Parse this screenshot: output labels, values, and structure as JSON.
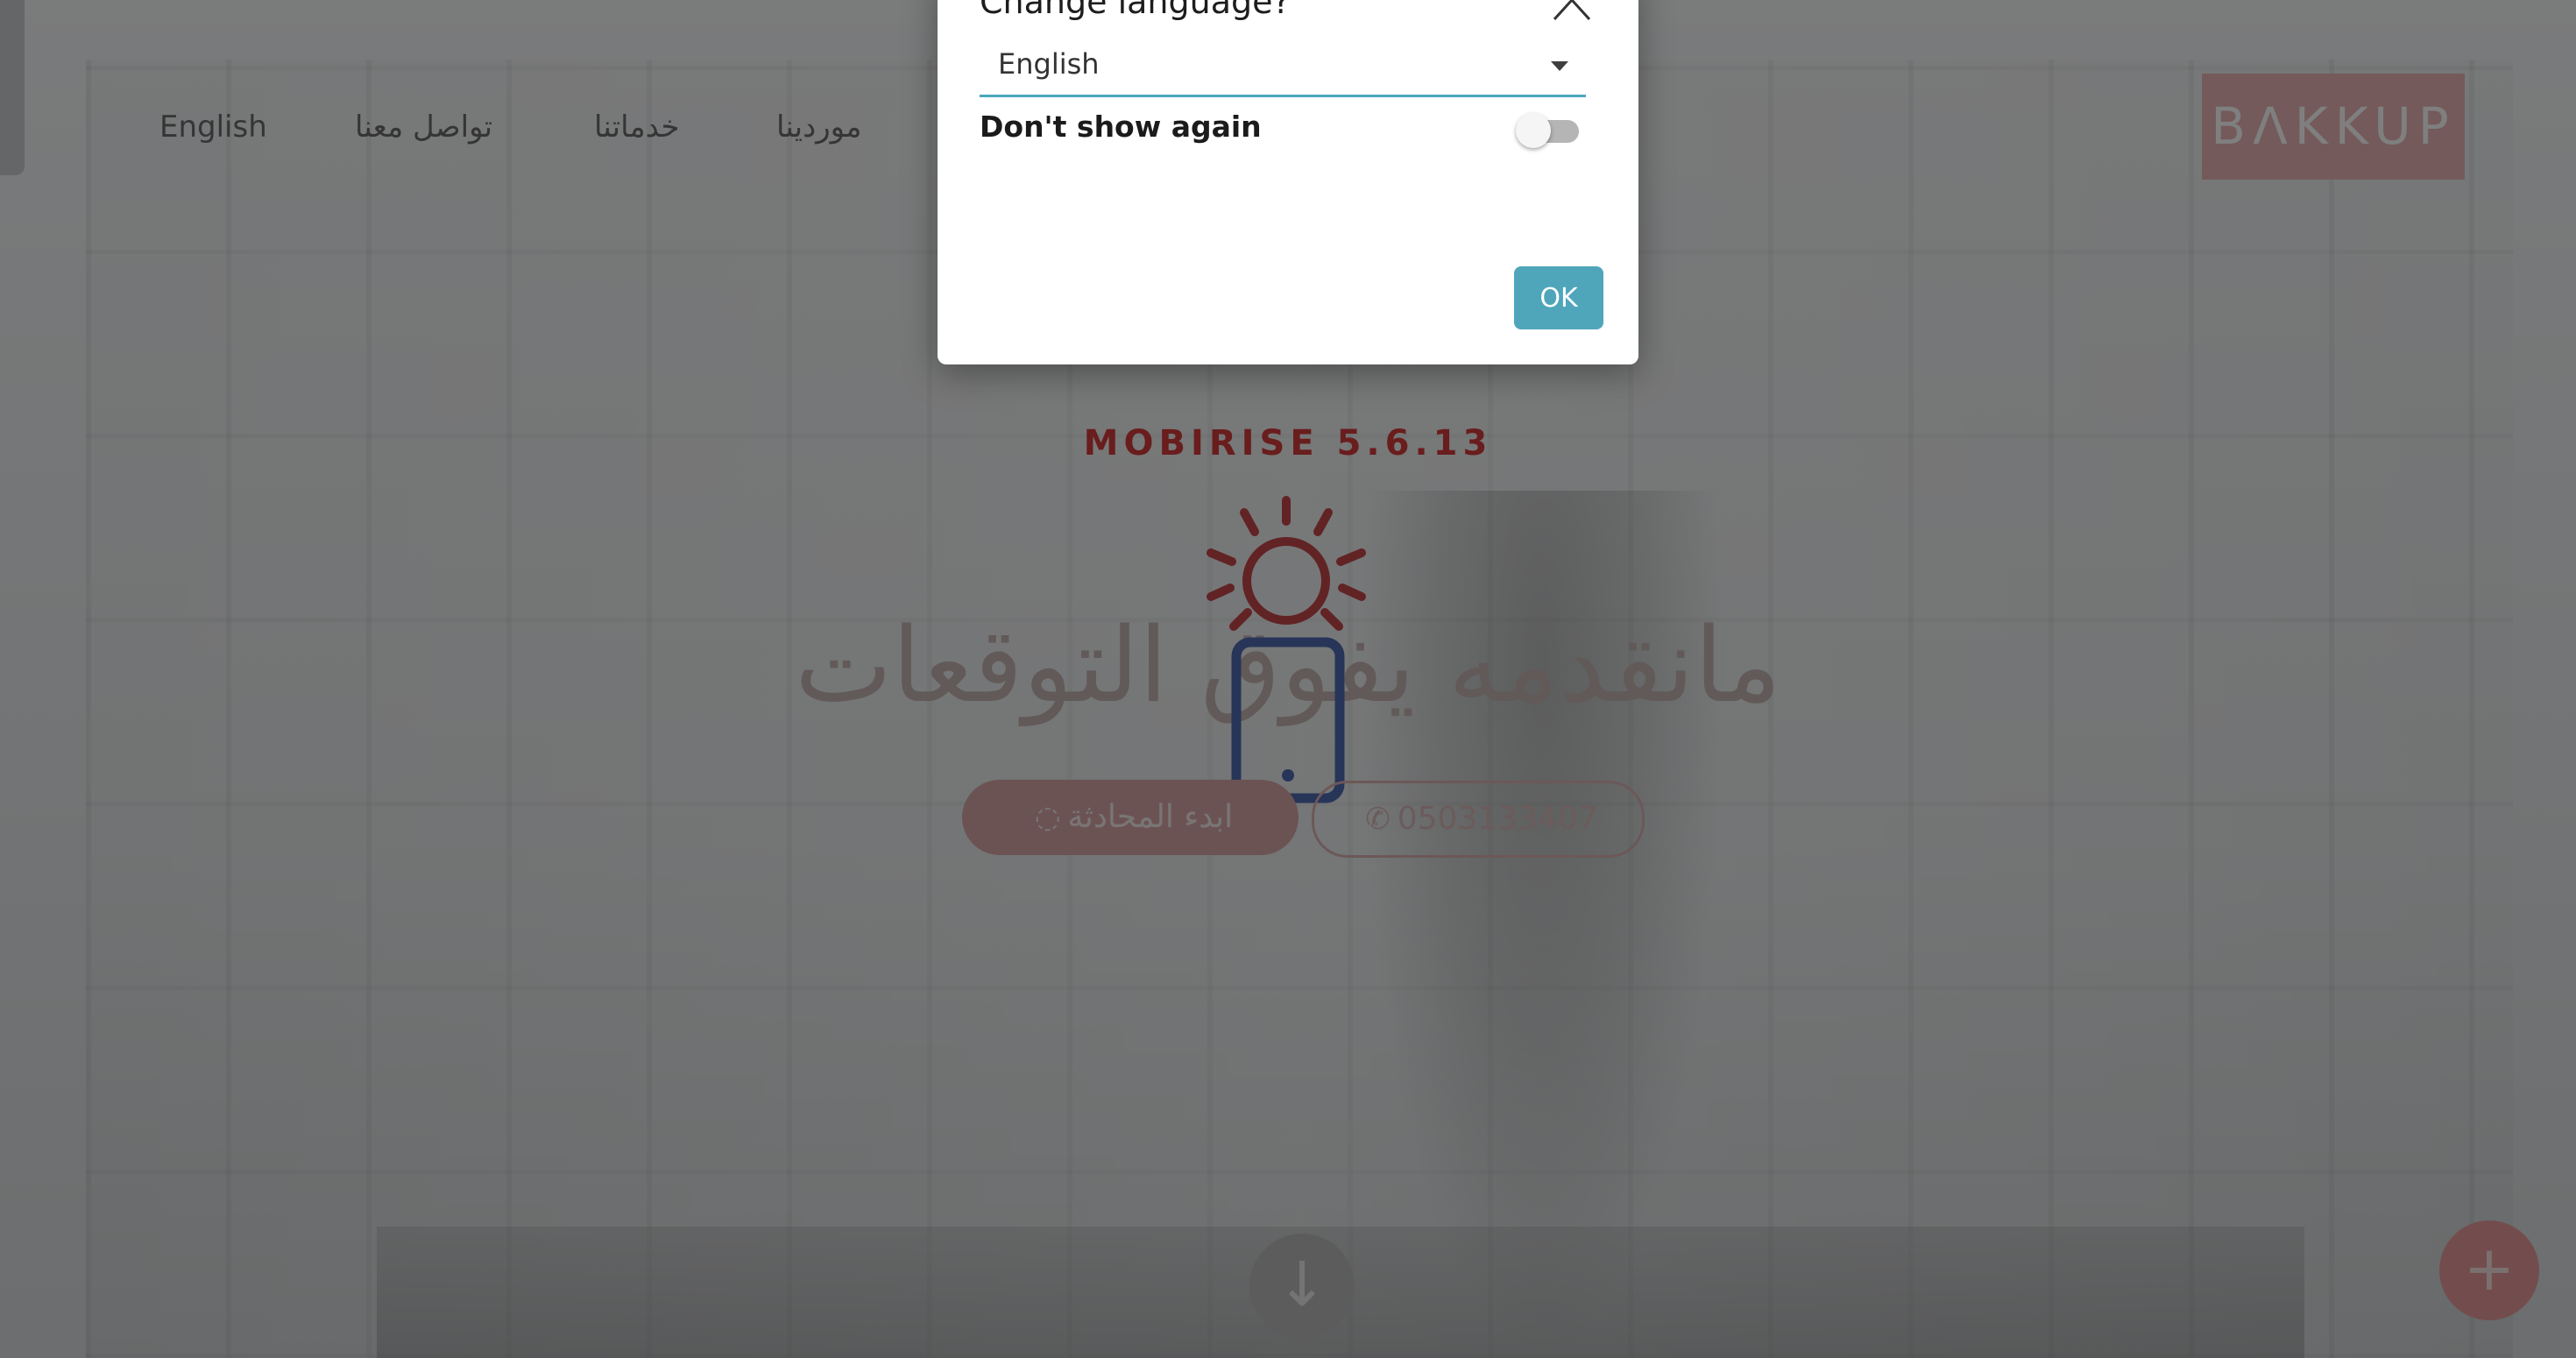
{
  "nav": {
    "items": [
      "English",
      "تواصل معنا",
      "خدماتنا",
      "موردينا"
    ],
    "brand": "BΛKKUP"
  },
  "hero": {
    "subtitle": "MOBIRISE  5.6.13",
    "title": "مانقدمه يفوق التوقعات",
    "whatsapp_button": "ابدء المحادثة",
    "phone_button": "0503133407",
    "sun_icon": "sun-icon",
    "phone_icon": "smartphone-icon"
  },
  "dialog": {
    "title": "Change language?",
    "selected_language": "English",
    "dont_show_again": "Don't show again",
    "dont_show_again_enabled": false,
    "ok_label": "OK"
  },
  "colors": {
    "accent": "#4fa6bb",
    "brand": "#e8b4b4",
    "hero_subtitle": "#d33a3a"
  }
}
